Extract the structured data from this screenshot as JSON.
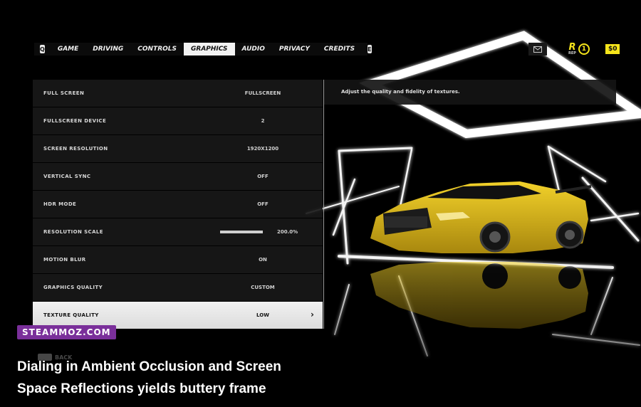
{
  "tabs": [
    "GAME",
    "DRIVING",
    "CONTROLS",
    "GRAPHICS",
    "AUDIO",
    "PRIVACY",
    "CREDITS"
  ],
  "active_tab": "GRAPHICS",
  "key_left": "Q",
  "key_right": "E",
  "hud": {
    "rep_letter": "R",
    "rep_sub": "REP",
    "rep_level": "1",
    "cash": "$0"
  },
  "settings": [
    {
      "label": "FULL SCREEN",
      "value": "FULLSCREEN"
    },
    {
      "label": "FULLSCREEN DEVICE",
      "value": "2"
    },
    {
      "label": "SCREEN RESOLUTION",
      "value": "1920X1200"
    },
    {
      "label": "VERTICAL SYNC",
      "value": "OFF"
    },
    {
      "label": "HDR MODE",
      "value": "OFF"
    },
    {
      "label": "RESOLUTION SCALE",
      "value": "200.0%",
      "slider": 1.0
    },
    {
      "label": "MOTION BLUR",
      "value": "ON"
    },
    {
      "label": "GRAPHICS QUALITY",
      "value": "CUSTOM"
    },
    {
      "label": "TEXTURE QUALITY",
      "value": "LOW",
      "selected": true
    }
  ],
  "description": "Adjust the quality and fidelity of textures.",
  "back_label": "BACK",
  "watermark": "STEAMMOZ.COM",
  "caption": "Dialing in Ambient Occlusion and Screen Space Reflections yields buttery frame",
  "colors": {
    "accent": "#f6e51b",
    "car": "#e6c21a",
    "watermark": "#7a2f9a"
  }
}
